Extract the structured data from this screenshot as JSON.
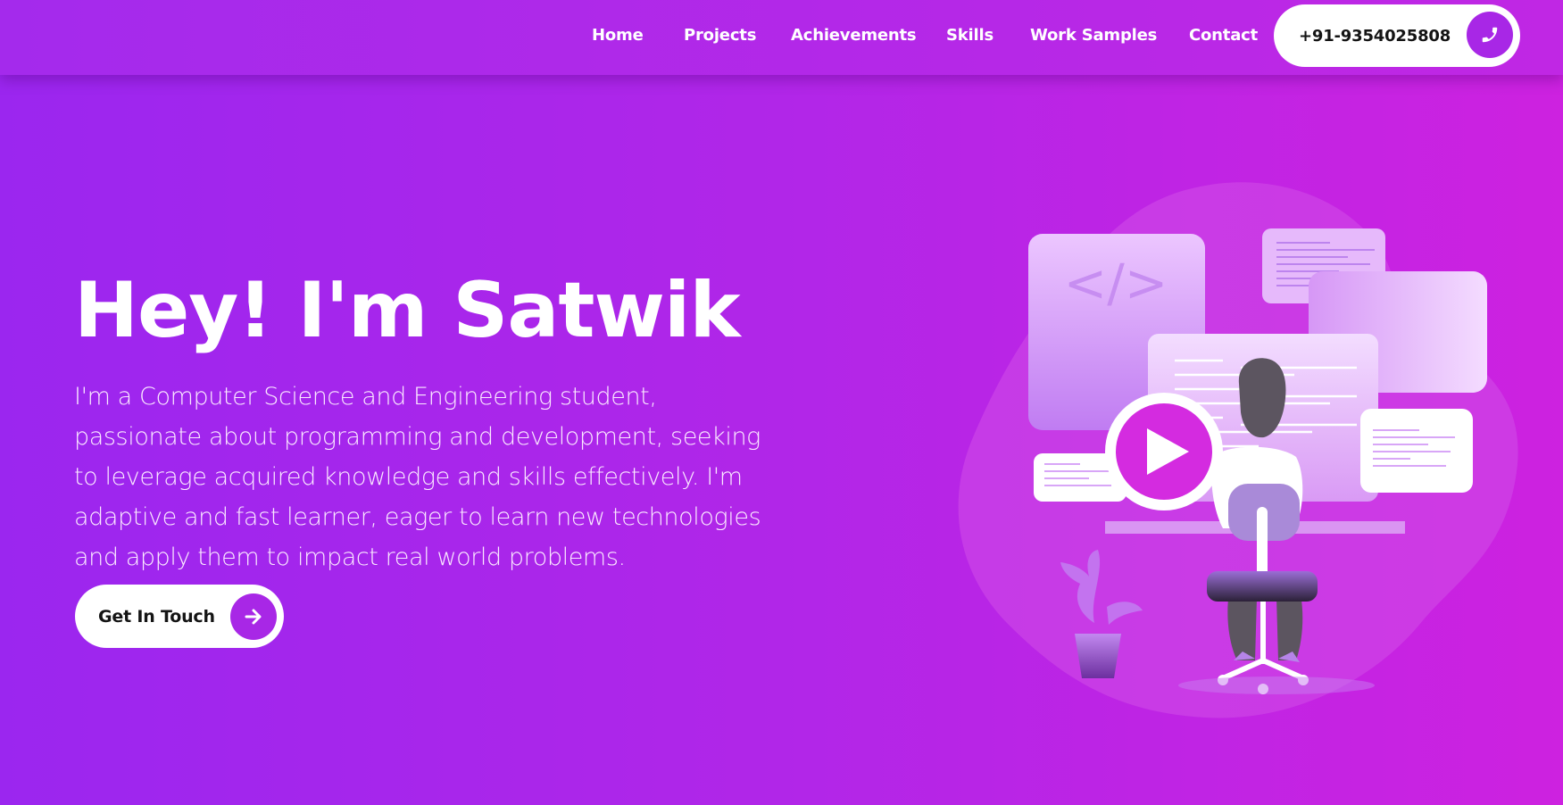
{
  "nav": {
    "items": [
      {
        "label": "Home"
      },
      {
        "label": "Projects"
      },
      {
        "label": "Achievements"
      },
      {
        "label": "Skills"
      },
      {
        "label": "Work Samples"
      },
      {
        "label": "Contact"
      }
    ],
    "phone": "+91-9354025808",
    "phone_icon": "phone-icon"
  },
  "hero": {
    "title": "Hey! I'm Satwik",
    "description": "I'm a Computer Science and Engineering student, passionate about programming and development, seeking to leverage acquired knowledge and skills effectively. I'm adaptive and fast learner, eager to learn new technologies and apply them to impact real world problems.",
    "cta_label": "Get In Touch",
    "cta_icon": "arrow-right-icon",
    "illustration_icon": "developer-illustration",
    "code_symbol": "</>"
  },
  "colors": {
    "gradient_start": "#9b26ef",
    "gradient_end": "#cd22e0",
    "accent": "#a827e6",
    "play_button": "#d42be0"
  }
}
